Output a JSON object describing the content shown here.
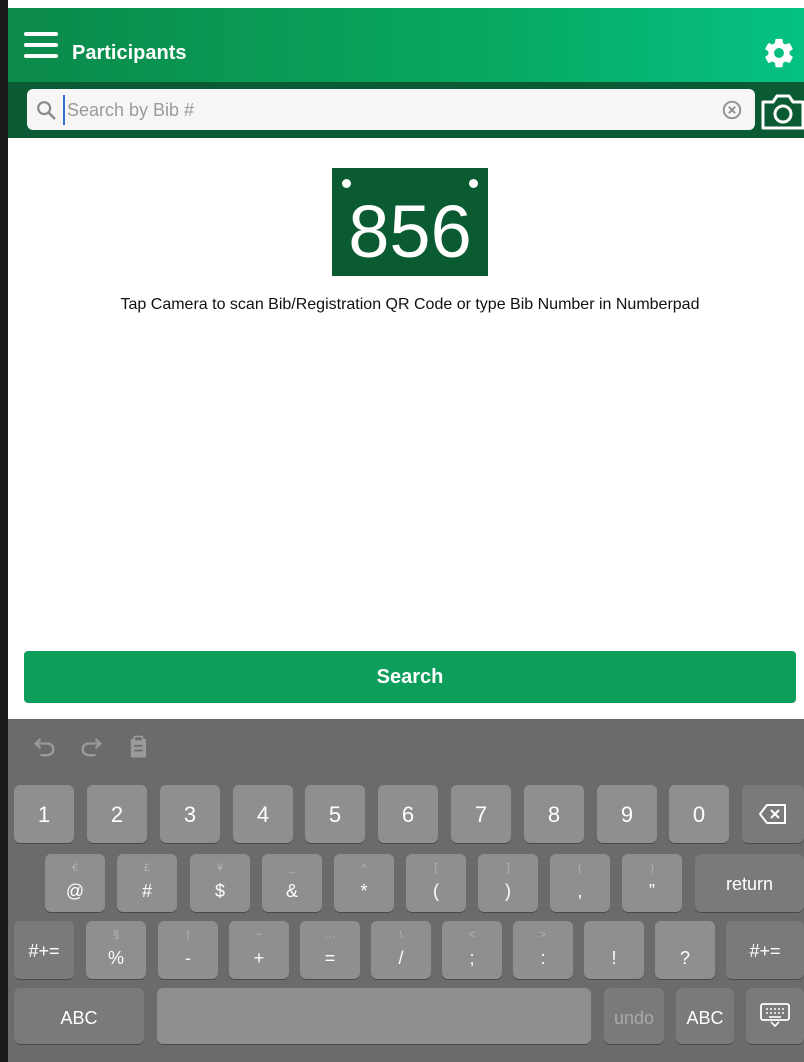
{
  "header": {
    "title": "Participants"
  },
  "search": {
    "placeholder": "Search by Bib #",
    "value": ""
  },
  "bib": {
    "number": "856"
  },
  "hint": "Tap Camera to scan Bib/Registration QR Code or type Bib Number in Numberpad",
  "search_button": "Search",
  "keyboard": {
    "row1": [
      "1",
      "2",
      "3",
      "4",
      "5",
      "6",
      "7",
      "8",
      "9",
      "0"
    ],
    "row2": [
      {
        "main": "@",
        "sub": "€"
      },
      {
        "main": "#",
        "sub": "£"
      },
      {
        "main": "$",
        "sub": "¥"
      },
      {
        "main": "&",
        "sub": "_"
      },
      {
        "main": "*",
        "sub": "^"
      },
      {
        "main": "(",
        "sub": "["
      },
      {
        "main": ")",
        "sub": "]"
      },
      {
        "main": ",",
        "sub": "("
      },
      {
        "main": "”",
        "sub": ")"
      }
    ],
    "return_label": "return",
    "row3": [
      {
        "main": "%",
        "sub": "§"
      },
      {
        "main": "-",
        "sub": "|"
      },
      {
        "main": "+",
        "sub": "~"
      },
      {
        "main": "=",
        "sub": "…"
      },
      {
        "main": "/",
        "sub": "\\"
      },
      {
        "main": ";",
        "sub": "<"
      },
      {
        "main": ":",
        "sub": ">"
      },
      {
        "main": "!",
        "sub": ""
      },
      {
        "main": "?",
        "sub": ""
      }
    ],
    "symbols_label": "#+=",
    "abc_label": "ABC",
    "undo_label": "undo"
  },
  "colors": {
    "accent": "#0c9e5a",
    "header_dark": "#0a5b33",
    "bib_bg": "#0a5a32"
  }
}
